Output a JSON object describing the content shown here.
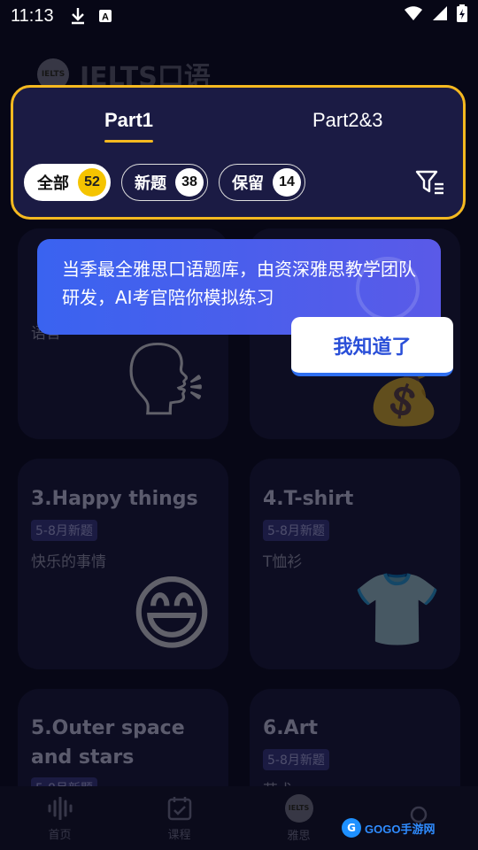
{
  "status_bar": {
    "time": "11:13"
  },
  "header": {
    "logo_text": "IELTS",
    "title": "IELTS口语"
  },
  "tabs": [
    {
      "label": "Part1",
      "active": true
    },
    {
      "label": "Part2&3",
      "active": false
    }
  ],
  "filters": [
    {
      "label": "全部",
      "count": "52",
      "active": true
    },
    {
      "label": "新题",
      "count": "38",
      "active": false
    },
    {
      "label": "保留",
      "count": "14",
      "active": false
    }
  ],
  "tooltip": {
    "text": "当季最全雅思口语题库，由资深雅思教学团队研发，AI考官陪你模拟练习",
    "button": "我知道了"
  },
  "cards": [
    {
      "title": "",
      "tag": "",
      "subtitle": "语言",
      "emoji": "🗣"
    },
    {
      "title": "",
      "tag": "",
      "subtitle": "",
      "emoji": "💰"
    },
    {
      "title": "3.Happy things",
      "tag": "5-8月新题",
      "subtitle": "快乐的事情",
      "emoji": "😄"
    },
    {
      "title": "4.T-shirt",
      "tag": "5-8月新题",
      "subtitle": "T恤衫",
      "emoji": "👕"
    },
    {
      "title": "5.Outer space and stars",
      "tag": "5-8月新题",
      "subtitle": "",
      "emoji": ""
    },
    {
      "title": "6.Art",
      "tag": "5-8月新题",
      "subtitle": "艺术",
      "emoji": ""
    }
  ],
  "bottom_nav": [
    {
      "label": "首页",
      "icon": "waveform-icon"
    },
    {
      "label": "课程",
      "icon": "calendar-check-icon"
    },
    {
      "label": "雅思",
      "icon": "ielts-badge-icon"
    },
    {
      "label": "",
      "icon": "profile-icon"
    }
  ],
  "watermark": {
    "text": "GOGO手游网"
  }
}
